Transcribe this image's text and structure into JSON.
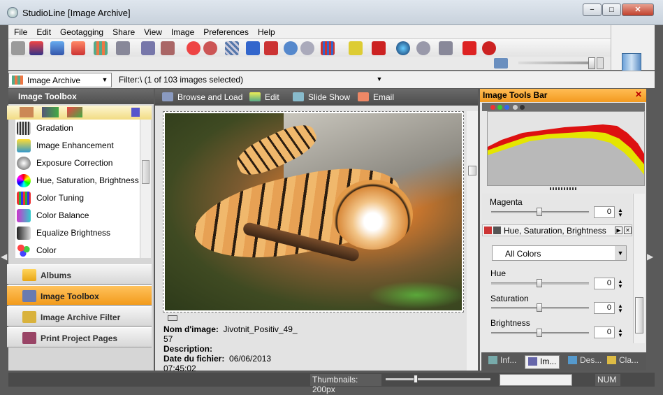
{
  "window": {
    "title": "StudioLine [Image Archive]",
    "minimize": "−",
    "restore": "□",
    "close": "✕"
  },
  "menu": [
    "File",
    "Edit",
    "Geotagging",
    "Share",
    "View",
    "Image",
    "Preferences",
    "Help"
  ],
  "address": {
    "archive": "Image Archive",
    "filter": "Filter:\\ (1 of 103 images selected)"
  },
  "left_panel": {
    "title": "Image Toolbox",
    "tools": [
      "Gradation",
      "Image Enhancement",
      "Exposure Correction",
      "Hue, Saturation, Brightness",
      "Color Tuning",
      "Color Balance",
      "Equalize Brightness",
      "Color"
    ],
    "nav": [
      "Albums",
      "Image Toolbox",
      "Image Archive Filter",
      "Print Project Pages"
    ]
  },
  "view_tabs": [
    "Browse and Load",
    "Edit",
    "Slide Show",
    "Email"
  ],
  "meta": {
    "name_label": "Nom d'image:",
    "name_value": "Jivotnit_Positiv_49_",
    "name_value2": "57",
    "desc_label": "Description:",
    "date_label": "Date du fichier:",
    "date_value": "06/06/2013",
    "time_value": "07:45:02"
  },
  "right_panel": {
    "title": "Image Tools Bar",
    "close": "✕",
    "magenta_label": "Magenta",
    "magenta_value": "0",
    "hsb_title": "Hue, Saturation, Brightness",
    "color_select": "All Colors",
    "hue_label": "Hue",
    "hue_value": "0",
    "sat_label": "Saturation",
    "sat_value": "0",
    "bri_label": "Brightness",
    "bri_value": "0",
    "tabs": [
      "Inf...",
      "Im...",
      "Des...",
      "Cla..."
    ]
  },
  "status": {
    "thumbnails": "Thumbnails: 200px",
    "num": "NUM"
  },
  "colors": {
    "accent": "#f39a1f",
    "panel_dark": "#4f4f4f"
  }
}
